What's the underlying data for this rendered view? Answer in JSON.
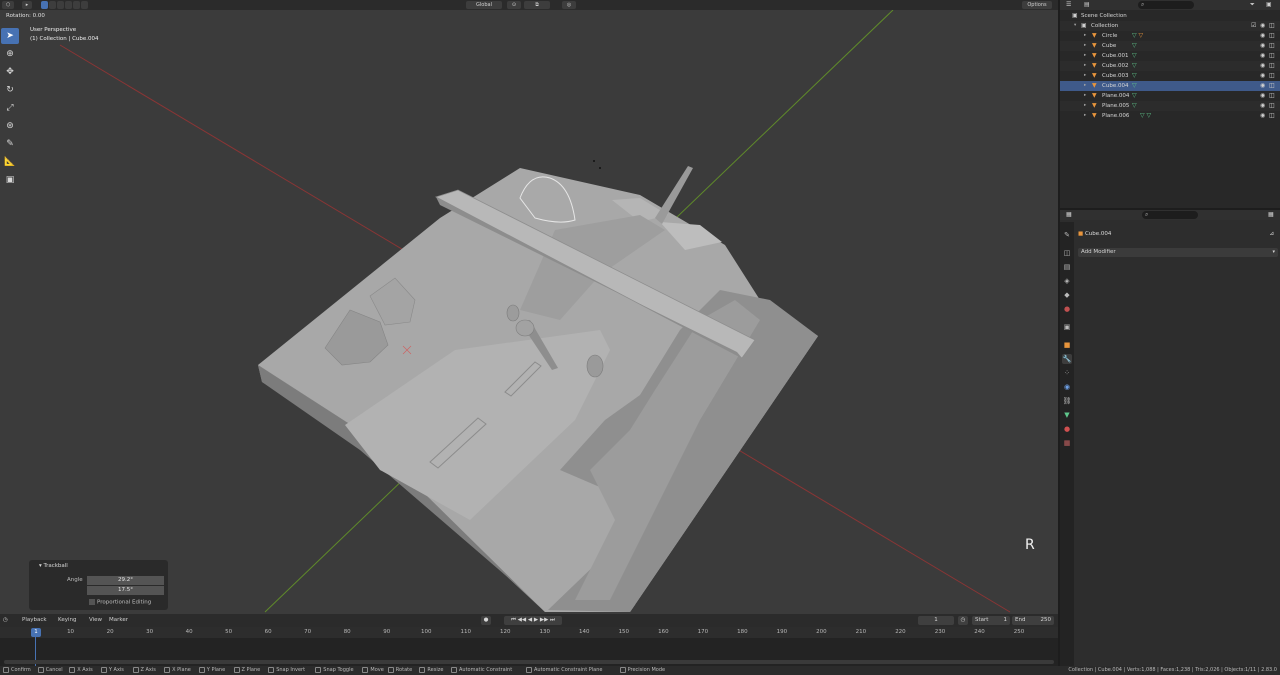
{
  "viewport": {
    "header_buttons": [
      "Global"
    ],
    "options_label": "Options",
    "rotation_readout": "Rotation: 0.00",
    "view_name": "User Perspective",
    "view_context": "(1) Collection | Cube.004",
    "key_hint": "R",
    "tools": [
      "select-tool",
      "cursor-tool",
      "move-tool",
      "rotate-tool",
      "scale-tool",
      "transform-tool",
      "annotate-tool",
      "measure-tool",
      "add-cube-tool"
    ]
  },
  "operator_panel": {
    "title": "Trackball",
    "angle_label": "Angle",
    "angle_value_1": "29.2°",
    "angle_value_2": "17.5°",
    "proportional_label": "Proportional Editing"
  },
  "timeline": {
    "menus": [
      "Playback",
      "Keying",
      "View",
      "Marker"
    ],
    "current_frame": "1",
    "start_label": "Start",
    "start_value": "1",
    "end_label": "End",
    "end_value": "250",
    "ticks": [
      "1",
      "10",
      "20",
      "30",
      "40",
      "50",
      "60",
      "70",
      "80",
      "90",
      "100",
      "110",
      "120",
      "130",
      "140",
      "150",
      "160",
      "170",
      "180",
      "190",
      "200",
      "210",
      "220",
      "230",
      "240",
      "250"
    ],
    "cursor_label": "1"
  },
  "statusbar": {
    "hints": [
      "Confirm",
      "Cancel",
      "X Axis",
      "Y Axis",
      "Z Axis",
      "X Plane",
      "Y Plane",
      "Z Plane",
      "Snap Invert",
      "Snap Toggle",
      "Move",
      "Rotate",
      "Resize",
      "Automatic Constraint",
      "Automatic Constraint Plane",
      "Precision Mode"
    ],
    "scene_stats": "Collection | Cube.004 | Verts:1,088 | Faces:1,238 | Tris:2,026 | Objects:1/11 | 2.83.0"
  },
  "outliner": {
    "scene_collection": "Scene Collection",
    "collection": "Collection",
    "items": [
      {
        "name": "Circle",
        "selected": false
      },
      {
        "name": "Cube",
        "selected": false
      },
      {
        "name": "Cube.001",
        "selected": false
      },
      {
        "name": "Cube.002",
        "selected": false
      },
      {
        "name": "Cube.003",
        "selected": false
      },
      {
        "name": "Cube.004",
        "selected": true
      },
      {
        "name": "Plane.004",
        "selected": false
      },
      {
        "name": "Plane.005",
        "selected": false
      },
      {
        "name": "Plane.006",
        "selected": false
      }
    ]
  },
  "properties": {
    "object_name": "Cube.004",
    "add_modifier": "Add Modifier",
    "active_tab": "modifier-tab"
  },
  "colors": {
    "accent": "#4772b3",
    "object_icon": "#e8953c",
    "modifier_icon": "#5fc78c",
    "x_axis": "#9c3b3b",
    "y_axis": "#6e9a2e"
  }
}
